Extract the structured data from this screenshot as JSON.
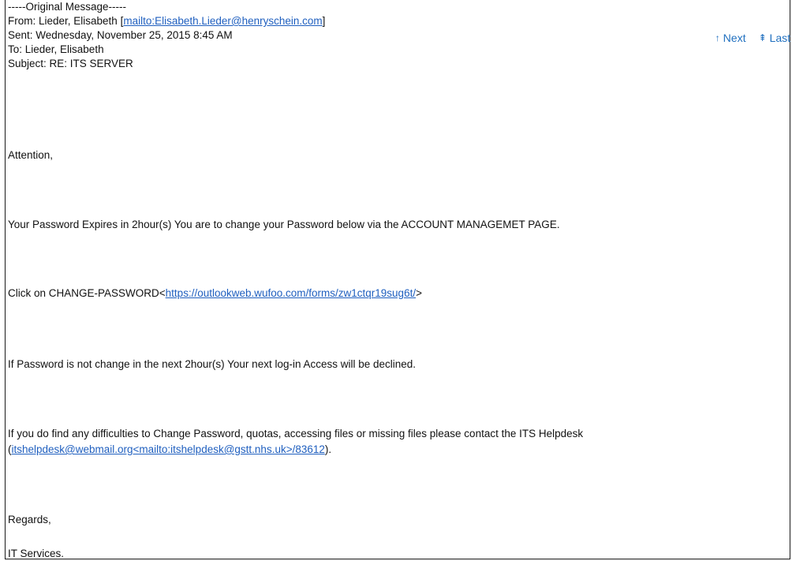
{
  "nav": {
    "next_icon": "↑",
    "next_label": "Next",
    "last_icon": "⇞",
    "last_label": "Last"
  },
  "header": {
    "original_marker": "-----Original Message-----",
    "from_prefix": "From: Lieder, Elisabeth [",
    "from_link": "mailto:Elisabeth.Lieder@henryschein.com",
    "from_suffix": "]",
    "sent": "Sent: Wednesday, November 25, 2015 8:45 AM",
    "to": "To: Lieder, Elisabeth",
    "subject": "Subject: RE: ITS SERVER"
  },
  "body": {
    "greeting": "Attention,",
    "expiry": "Your Password Expires in 2hour(s) You are to change your Password below via the ACCOUNT MANAGEMET PAGE.",
    "click_prefix": "Click on CHANGE-PASSWORD<",
    "click_link": "https://outlookweb.wufoo.com/forms/zw1ctqr19sug6t/",
    "click_suffix": ">",
    "warning": " If Password is not change in the next 2hour(s) Your next log-in Access will be declined.",
    "help_line1": "If you do find any difficulties to Change Password, quotas, accessing files or missing files please contact the ITS Helpdesk",
    "help_open": "(",
    "help_link": "itshelpdesk@webmail.org<mailto:itshelpdesk@gstt.nhs.uk>/83612",
    "help_close": ").",
    "regards": "Regards,",
    "signature": "IT Services."
  }
}
